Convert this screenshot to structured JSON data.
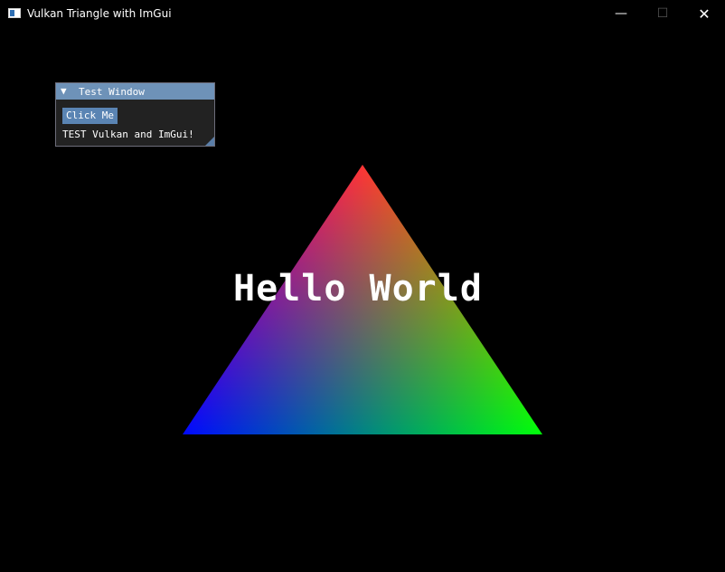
{
  "window": {
    "title": "Vulkan Triangle with ImGui",
    "controls": {
      "minimize": "—",
      "maximize": "☐",
      "close": "✕"
    }
  },
  "imgui": {
    "collapse_icon": "▼",
    "title": "Test Window",
    "button_label": "Click Me",
    "text": "TEST Vulkan and ImGui!"
  },
  "scene": {
    "overlay_text": "Hello World",
    "vertex_colors": {
      "top": "#ff0000",
      "bottom_left": "#0000ff",
      "bottom_right": "#00ff00"
    },
    "accent_title": "#6e92b8",
    "accent_button": "#5a84b3"
  }
}
